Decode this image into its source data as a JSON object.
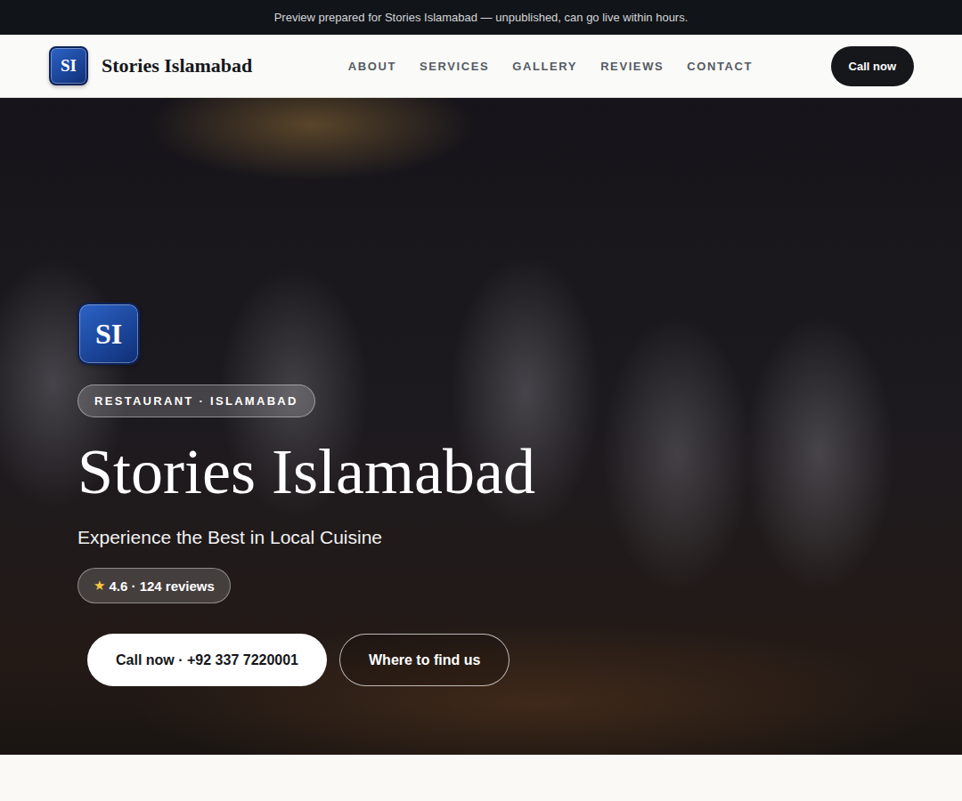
{
  "preview_banner": "Preview prepared for Stories Islamabad — unpublished, can go live within hours.",
  "header": {
    "logo": "SI",
    "brand": "Stories Islamabad",
    "nav": [
      {
        "label": "ABOUT"
      },
      {
        "label": "SERVICES"
      },
      {
        "label": "GALLERY"
      },
      {
        "label": "REVIEWS"
      },
      {
        "label": "CONTACT"
      }
    ],
    "cta": "Call now"
  },
  "hero": {
    "logo": "SI",
    "tag": "RESTAURANT · ISLAMABAD",
    "title": "Stories Islamabad",
    "subtitle": "Experience the Best in Local Cuisine",
    "rating": {
      "star": "★",
      "text": "4.6 · 124 reviews"
    },
    "buttons": [
      {
        "label": "Call now · +92 337 7220001",
        "kind": "primary"
      },
      {
        "label": "Where to find us",
        "kind": "outline"
      }
    ]
  }
}
